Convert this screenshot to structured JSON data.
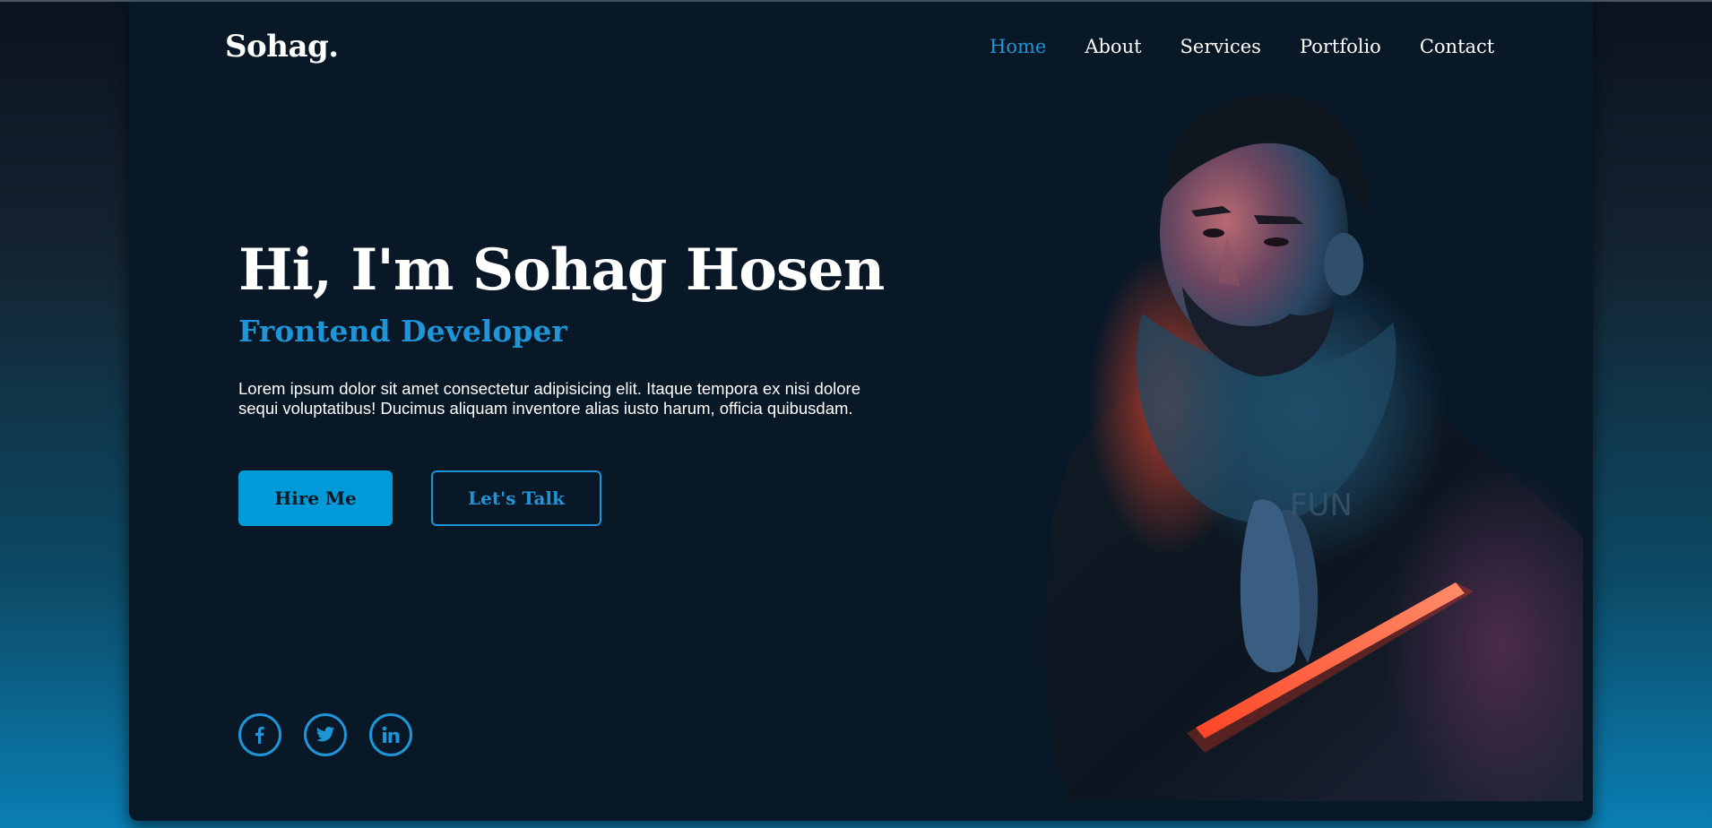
{
  "logo": "Sohag.",
  "nav": {
    "items": [
      {
        "label": "Home",
        "active": true
      },
      {
        "label": "About",
        "active": false
      },
      {
        "label": "Services",
        "active": false
      },
      {
        "label": "Portfolio",
        "active": false
      },
      {
        "label": "Contact",
        "active": false
      }
    ]
  },
  "hero": {
    "title": "Hi, I'm Sohag Hosen",
    "subtitle": "Frontend Developer",
    "text": "Lorem ipsum dolor sit amet consectetur adipisicing elit. Itaque tempora ex nisi dolore sequi voluptatibus! Ducimus aliquam inventore alias iusto harum, officia quibusdam.",
    "hire_label": "Hire Me",
    "talk_label": "Let's Talk"
  },
  "socials": [
    {
      "icon": "facebook-icon"
    },
    {
      "icon": "twitter-icon"
    },
    {
      "icon": "linkedin-icon"
    }
  ],
  "portrait": {
    "shirt_letters": "FUN"
  },
  "colors": {
    "accent": "#1f95d8",
    "button": "#009ad8",
    "card_bg": "#091827",
    "text": "#ffffff"
  }
}
